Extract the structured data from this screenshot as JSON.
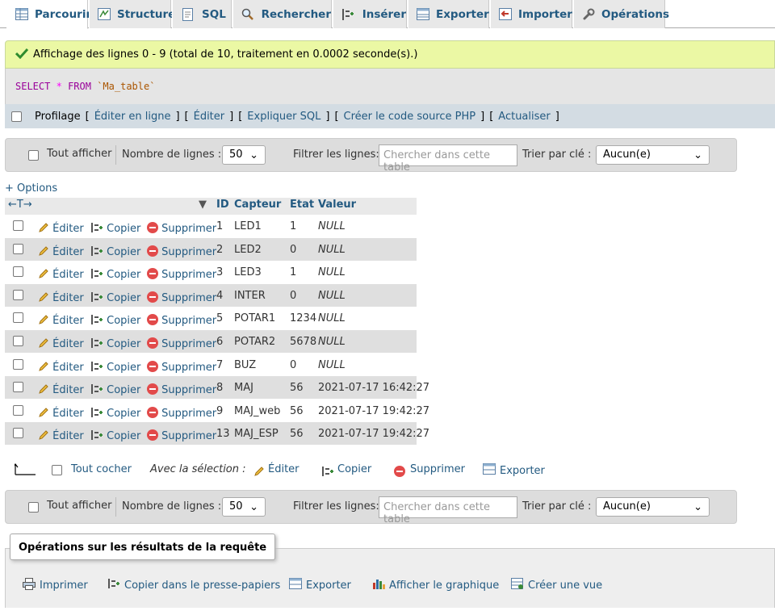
{
  "tabs": [
    {
      "label": "Parcourir",
      "icon": "table-browse-icon",
      "active": true
    },
    {
      "label": "Structure",
      "icon": "structure-icon"
    },
    {
      "label": "SQL",
      "icon": "sql-icon"
    },
    {
      "label": "Rechercher",
      "icon": "search-icon"
    },
    {
      "label": "Insérer",
      "icon": "insert-icon"
    },
    {
      "label": "Exporter",
      "icon": "export-icon"
    },
    {
      "label": "Importer",
      "icon": "import-icon"
    },
    {
      "label": "Opérations",
      "icon": "wrench-icon"
    }
  ],
  "message": {
    "text": "Affichage des lignes 0 - 9 (total de 10, traitement en 0.0002 seconde(s).)"
  },
  "query": {
    "kw_select": "SELECT",
    "star": "*",
    "kw_from": "FROM",
    "table": "`Ma_table`"
  },
  "query_actions": {
    "profiling": "Profilage",
    "edit_inline": "Éditer en ligne",
    "edit": "Éditer",
    "explain": "Expliquer SQL",
    "php_code": "Créer le code source PHP",
    "refresh": "Actualiser"
  },
  "navbar": {
    "show_all": "Tout afficher",
    "rows_label": "Nombre de lignes :",
    "rows_value": "50",
    "filter_label": "Filtrer les lignes:",
    "filter_placeholder": "Chercher dans cette table",
    "sort_label": "Trier par clé :",
    "sort_value": "Aucun(e)"
  },
  "options_link": "+ Options",
  "table": {
    "columns": [
      "ID",
      "Capteur",
      "Etat",
      "Valeur"
    ],
    "edit_label": "Éditer",
    "copy_label": "Copier",
    "delete_label": "Supprimer",
    "rows": [
      {
        "id": "1",
        "capteur": "LED1",
        "etat": "1",
        "valeur": "NULL",
        "is_null": true
      },
      {
        "id": "2",
        "capteur": "LED2",
        "etat": "0",
        "valeur": "NULL",
        "is_null": true
      },
      {
        "id": "3",
        "capteur": "LED3",
        "etat": "1",
        "valeur": "NULL",
        "is_null": true
      },
      {
        "id": "4",
        "capteur": "INTER",
        "etat": "0",
        "valeur": "NULL",
        "is_null": true
      },
      {
        "id": "5",
        "capteur": "POTAR1",
        "etat": "1234",
        "valeur": "NULL",
        "is_null": true
      },
      {
        "id": "6",
        "capteur": "POTAR2",
        "etat": "5678",
        "valeur": "NULL",
        "is_null": true
      },
      {
        "id": "7",
        "capteur": "BUZ",
        "etat": "0",
        "valeur": "NULL",
        "is_null": true
      },
      {
        "id": "8",
        "capteur": "MAJ",
        "etat": "56",
        "valeur": "2021-07-17 16:42:27",
        "is_null": false
      },
      {
        "id": "9",
        "capteur": "MAJ_web",
        "etat": "56",
        "valeur": "2021-07-17 19:42:27",
        "is_null": false
      },
      {
        "id": "13",
        "capteur": "MAJ_ESP",
        "etat": "56",
        "valeur": "2021-07-17 19:42:27",
        "is_null": false
      }
    ]
  },
  "selection": {
    "check_all": "Tout cocher",
    "with_selection": "Avec la sélection :",
    "edit": "Éditer",
    "copy": "Copier",
    "delete": "Supprimer",
    "export": "Exporter"
  },
  "query_results_ops": {
    "legend": "Opérations sur les résultats de la requête",
    "print": "Imprimer",
    "copy_clipboard": "Copier dans le presse-papiers",
    "export": "Exporter",
    "chart": "Afficher le graphique",
    "create_view": "Créer une vue"
  },
  "colors": {
    "link": "#235a81",
    "success_bg": "#ebf8a4",
    "even_row": "#dfdfdf",
    "delete_red": "#e24a4a"
  }
}
